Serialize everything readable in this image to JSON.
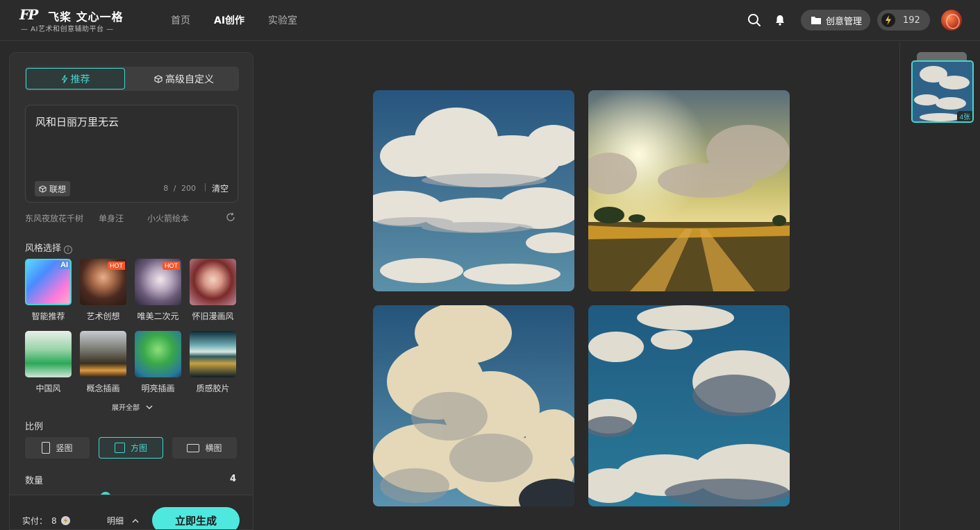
{
  "header": {
    "logo_mark": "FP",
    "logo_title": "飞桨 文心一格",
    "logo_subtitle": "— AI艺术和创意辅助平台 —",
    "nav": [
      {
        "label": "首页",
        "active": false
      },
      {
        "label": "AI创作",
        "active": true
      },
      {
        "label": "实验室",
        "active": false
      }
    ],
    "creative_manage_label": "创意管理",
    "credits": "192"
  },
  "left_panel": {
    "tabs": [
      {
        "label": "推荐",
        "active": true
      },
      {
        "label": "高级自定义",
        "active": false
      }
    ],
    "prompt": {
      "value": "风和日丽万里无云",
      "assoc_label": "联想",
      "count": "8",
      "separator": "/",
      "max": "200",
      "clear_label": "清空"
    },
    "suggestions": [
      "东风夜放花千树",
      "单身汪",
      "小火箭绘本"
    ],
    "style_label": "风格选择",
    "styles": [
      {
        "name": "智能推荐",
        "badge": "AI",
        "active": true
      },
      {
        "name": "艺术创想",
        "badge": "HOT",
        "active": false
      },
      {
        "name": "唯美二次元",
        "badge": "HOT",
        "active": false
      },
      {
        "name": "怀旧漫画风",
        "badge": "",
        "active": false
      },
      {
        "name": "中国风",
        "badge": "",
        "active": false
      },
      {
        "name": "概念插画",
        "badge": "",
        "active": false
      },
      {
        "name": "明亮插画",
        "badge": "",
        "active": false
      },
      {
        "name": "质感胶片",
        "badge": "",
        "active": false
      }
    ],
    "expand_label": "展开全部",
    "ratio_label": "比例",
    "ratios": [
      {
        "label": "竖图",
        "active": false
      },
      {
        "label": "方图",
        "active": true
      },
      {
        "label": "横图",
        "active": false
      }
    ],
    "quantity_label": "数量",
    "quantity_value": "4",
    "pay_label": "实付：",
    "pay_value": "8",
    "detail_label": "明细",
    "generate_label": "立即生成"
  },
  "right_rail": {
    "thumb_count": "4张"
  },
  "colors": {
    "accent": "#45d6cf",
    "generate_button": "#4ee8df",
    "hot_badge": "#f2572c",
    "background": "#2a2a2a",
    "panel": "#313131"
  }
}
